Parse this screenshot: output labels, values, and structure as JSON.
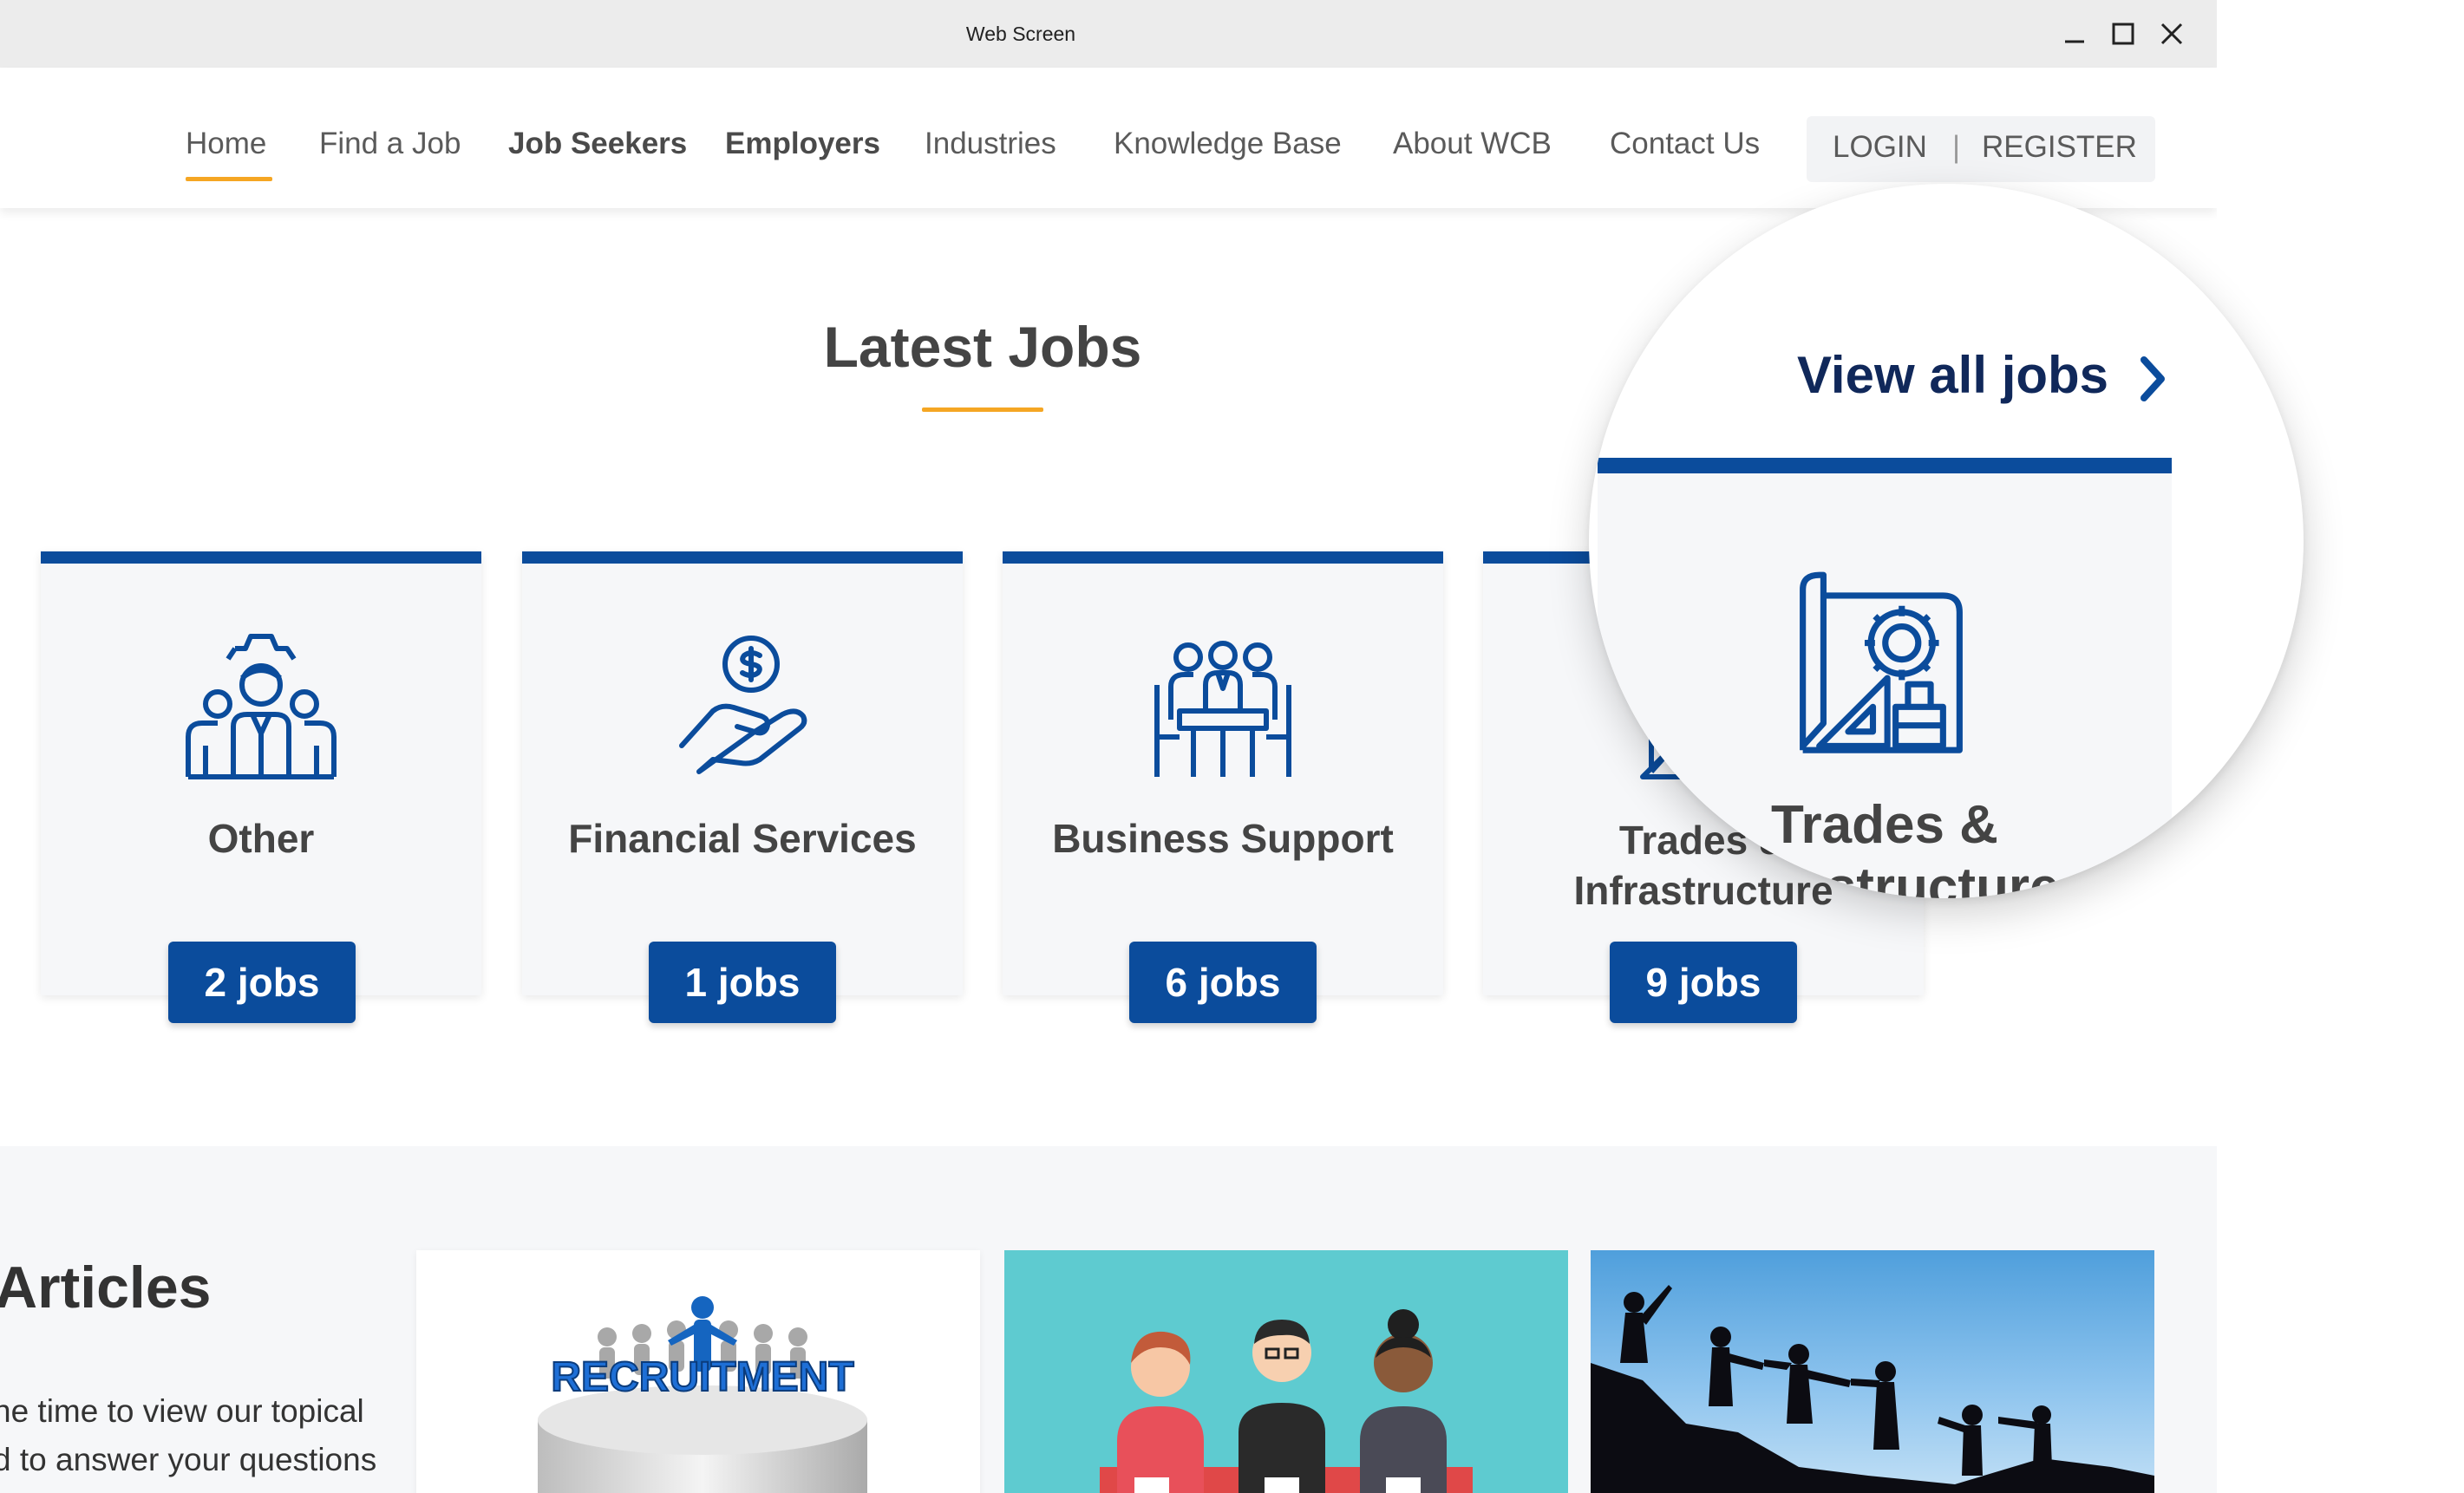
{
  "window": {
    "title": "Web Screen"
  },
  "nav": {
    "items": [
      {
        "label": "Home"
      },
      {
        "label": "Find a Job"
      },
      {
        "label": "Job Seekers"
      },
      {
        "label": "Employers"
      },
      {
        "label": "Industries"
      },
      {
        "label": "Knowledge Base"
      },
      {
        "label": "About WCB"
      },
      {
        "label": "Contact Us"
      }
    ],
    "login_label": "LOGIN",
    "separator": "|",
    "register_label": "REGISTER"
  },
  "latest_jobs": {
    "title": "Latest Jobs",
    "view_all_label": "View all jobs",
    "cards": [
      {
        "label": "Other",
        "jobs": "2 jobs",
        "icon": "team-gear-icon"
      },
      {
        "label": "Financial Services",
        "jobs": "1 jobs",
        "icon": "hand-coin-icon"
      },
      {
        "label": "Business Support",
        "jobs": "6 jobs",
        "icon": "meeting-table-icon"
      },
      {
        "label_line1": "Trades &",
        "label_line2": "Infrastructure",
        "jobs": "9 jobs",
        "icon": "blueprint-gear-icon"
      }
    ]
  },
  "magnifier": {
    "link_label": "View all jobs",
    "card_line1": "Trades &",
    "card_line2": "Infrastructure"
  },
  "articles": {
    "title": "Articles",
    "text_line1": "ne time to view our topical",
    "text_line2": "d to answer your questions",
    "images": [
      {
        "caption": "RECRUITMENT"
      },
      {
        "icon": "people-meeting-illustration"
      },
      {
        "icon": "climbers-silhouette-photo"
      }
    ]
  },
  "colors": {
    "brand_blue": "#0b4c9c",
    "dark_navy": "#10285a",
    "accent_orange": "#f5a623"
  }
}
